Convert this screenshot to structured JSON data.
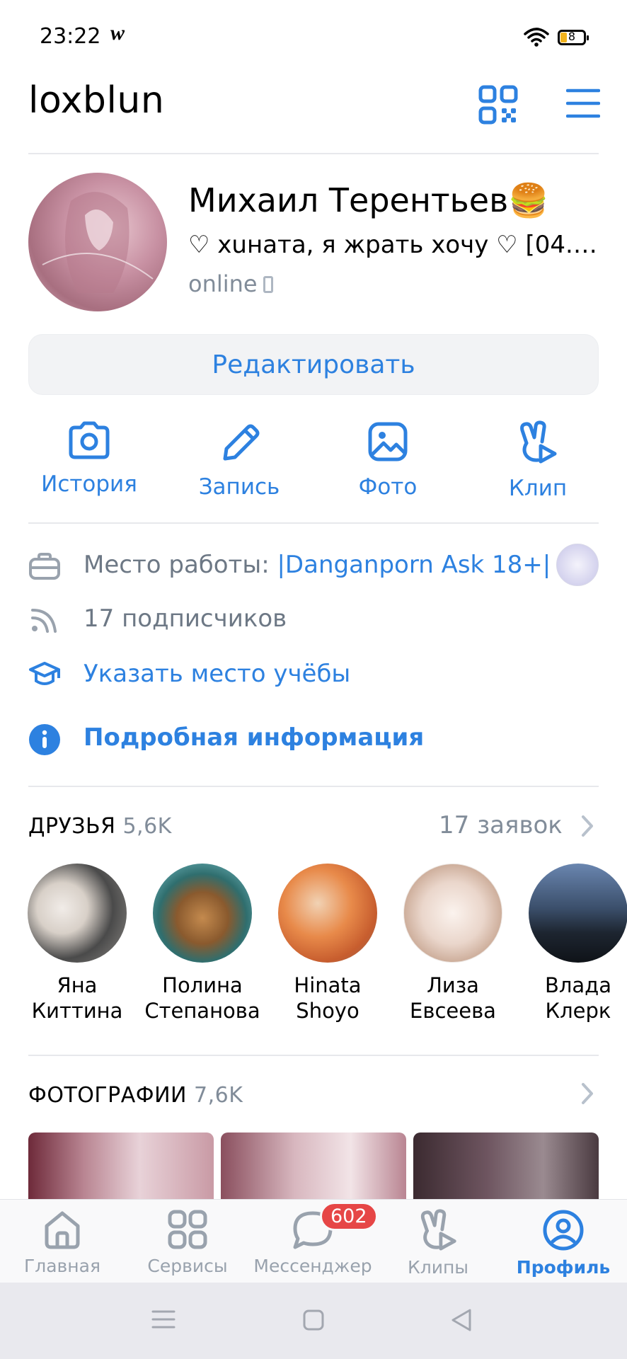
{
  "status_bar": {
    "time": "23:22",
    "app_glyph": "w",
    "battery_level": "8"
  },
  "header": {
    "username": "loxblun"
  },
  "profile": {
    "name": "Михаил Терентьев",
    "name_emoji": "🍔",
    "status": "♡ хuната, я жрать хочу ♡ [04.07....",
    "online": "online",
    "edit_label": "Редактировать"
  },
  "actions": [
    {
      "label": "История",
      "icon": "camera-icon"
    },
    {
      "label": "Запись",
      "icon": "pencil-icon"
    },
    {
      "label": "Фото",
      "icon": "photo-icon"
    },
    {
      "label": "Клип",
      "icon": "clip-icon"
    }
  ],
  "info": {
    "work_prefix": "Место работы: ",
    "work_link": "|Danganporn Ask 18+|",
    "subscribers": "17 подписчиков",
    "education": "Указать место учёбы",
    "details": "Подробная информация"
  },
  "friends": {
    "title": "ДРУЗЬЯ",
    "count": "5,6K",
    "requests": "17 заявок",
    "items": [
      {
        "line1": "Яна",
        "line2": "Киттина"
      },
      {
        "line1": "Полина",
        "line2": "Степанова"
      },
      {
        "line1": "Hinata",
        "line2": "Shoyo"
      },
      {
        "line1": "Лиза",
        "line2": "Евсеева"
      },
      {
        "line1": "Влада",
        "line2": "Клерк"
      }
    ]
  },
  "photos": {
    "title": "ФОТОГРАФИИ",
    "count": "7,6K"
  },
  "tabbar": {
    "items": [
      {
        "label": "Главная",
        "icon": "home-icon"
      },
      {
        "label": "Сервисы",
        "icon": "services-icon"
      },
      {
        "label": "Мессенджер",
        "icon": "messenger-icon"
      },
      {
        "label": "Клипы",
        "icon": "clips-icon"
      },
      {
        "label": "Профиль",
        "icon": "profile-icon"
      }
    ],
    "messenger_badge": "602",
    "active": "Профиль"
  },
  "colors": {
    "accent": "#2d81e0",
    "secondary": "#818c99",
    "badge": "#e64646"
  }
}
